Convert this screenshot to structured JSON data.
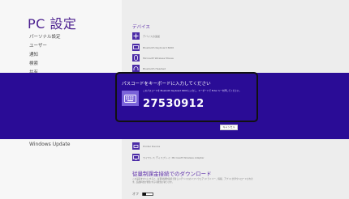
{
  "window": {
    "title": "PC 設定"
  },
  "sidebar": {
    "items": [
      {
        "label": "パーソナル設定"
      },
      {
        "label": "ユーザー"
      },
      {
        "label": "通知"
      },
      {
        "label": "検索"
      },
      {
        "label": "共有"
      }
    ],
    "bottom_item": {
      "label": "Windows Update"
    }
  },
  "devices": {
    "title": "デバイス",
    "add_device_label": "デバイスの追加",
    "rows": [
      {
        "label": "Bluetooth Keyboard 6000",
        "icon": "keyboard-icon"
      },
      {
        "label": "Microsoft Wireless Mouse",
        "icon": "mouse-icon"
      },
      {
        "label": "Bluetooth Headset",
        "icon": "headset-icon"
      },
      {
        "label": "Printer Device",
        "icon": "printer-icon"
      },
      {
        "label": "ワイヤレス ディスプレイ: Microsoft Wireless Adapter",
        "icon": "display-icon"
      }
    ]
  },
  "pairing_dialog": {
    "title": "パスコードをキーボードに入力してください",
    "message": "このパスコードを Bluetooth Keyboard 6000 に入力し、キーボードで Enter キーを押してください。",
    "passcode": "27530912",
    "cancel_label": "キャンセル",
    "icon": "keyboard-icon"
  },
  "metered": {
    "title": "従量制課金接続でのダウンロード",
    "description": "この設定をオンにすると、従量制課金接続で新しいデバイスのソフトウェア (ドライバー、情報、アプリ) がダウンロードされます。追加料金が発生する可能性があります。",
    "state_label": "オフ",
    "enabled": false
  },
  "colors": {
    "accent": "#2a0c96",
    "title_purple": "#4b1f8f",
    "link_purple": "#5b2ca8",
    "icon_purple": "#4b2ba6"
  }
}
